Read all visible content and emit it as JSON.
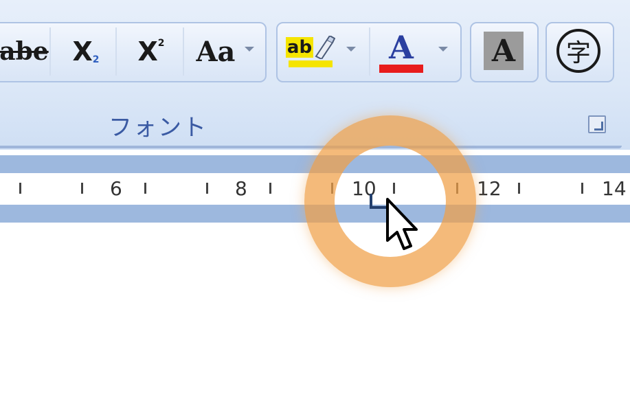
{
  "ribbon": {
    "font_group": {
      "label": "フォント",
      "buttons": {
        "strikethrough": "abe",
        "subscript": "X",
        "subscript_mark": "2",
        "superscript": "X",
        "superscript_mark": "2",
        "change_case": "Aa",
        "highlight": "ab",
        "font_color": "A",
        "char_shading": "A",
        "enclose_char": "字"
      },
      "colors": {
        "highlight": "#f5e400",
        "font_color": "#e81c1c"
      }
    }
  },
  "ruler": {
    "numbers": [
      "6",
      "8",
      "10",
      "12",
      "14"
    ]
  }
}
